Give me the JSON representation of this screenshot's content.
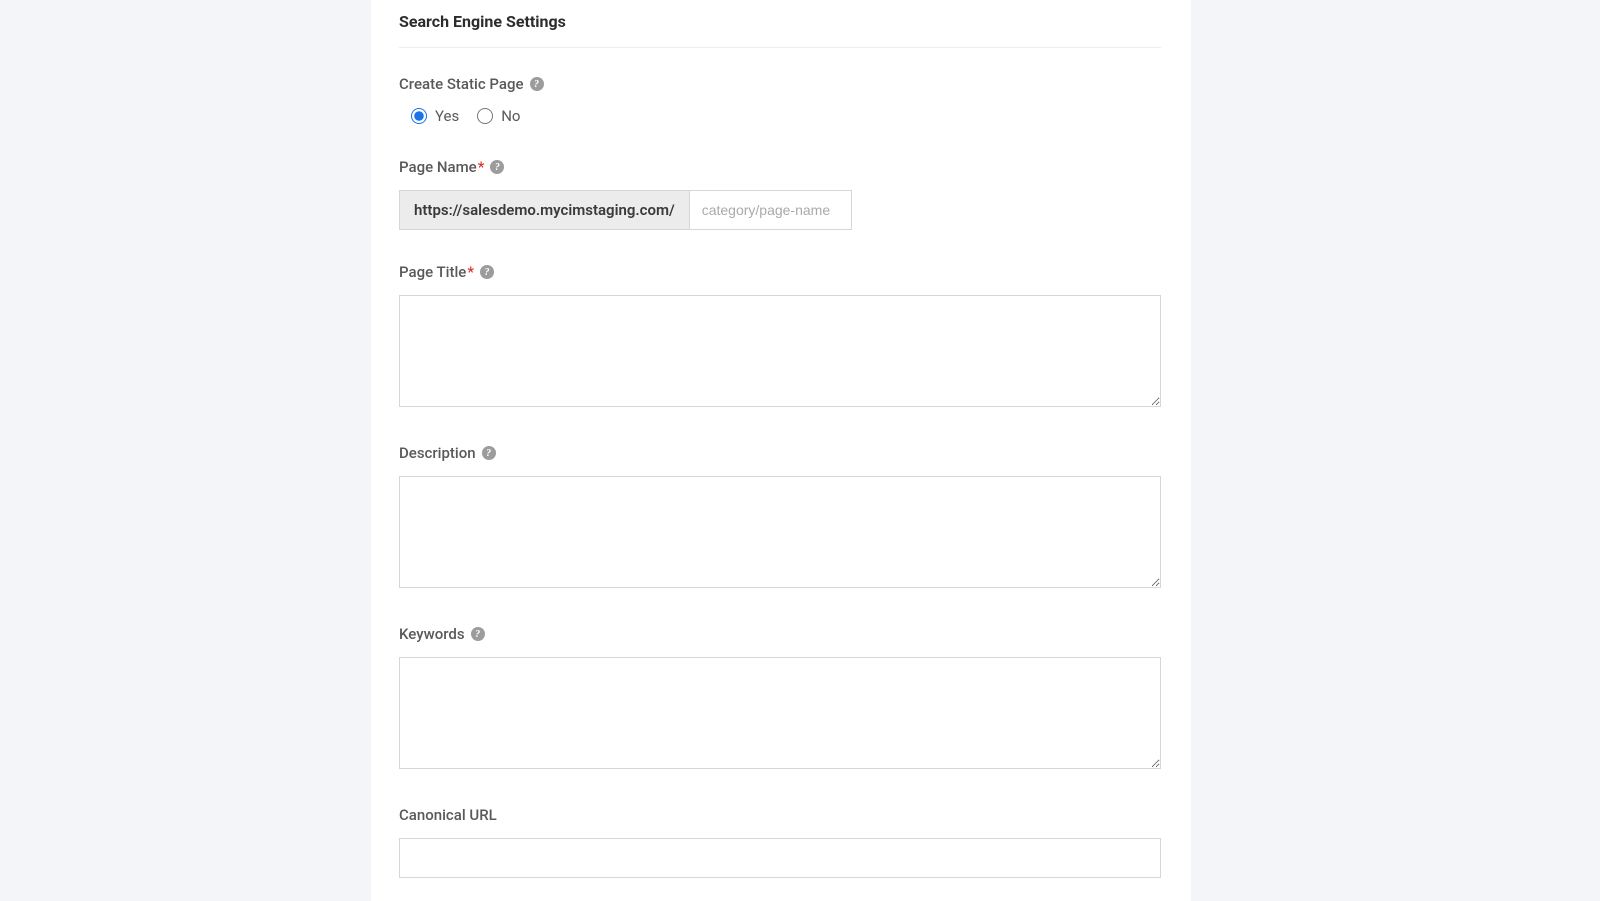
{
  "section": {
    "title": "Search Engine Settings"
  },
  "fields": {
    "create_static_page": {
      "label": "Create Static Page",
      "options": {
        "yes": "Yes",
        "no": "No"
      },
      "selected": "yes"
    },
    "page_name": {
      "label": "Page Name",
      "prefix": "https://salesdemo.mycimstaging.com/",
      "placeholder": "category/page-name",
      "value": ""
    },
    "page_title": {
      "label": "Page Title",
      "value": ""
    },
    "description": {
      "label": "Description",
      "value": ""
    },
    "keywords": {
      "label": "Keywords",
      "value": ""
    },
    "canonical_url": {
      "label": "Canonical URL",
      "value": ""
    }
  }
}
